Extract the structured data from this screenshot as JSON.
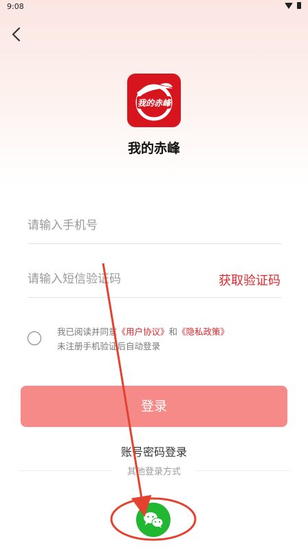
{
  "status_bar": {
    "time": "9:08"
  },
  "header": {
    "back_icon": "chevron-left-icon"
  },
  "app": {
    "logo_text": "我的赤峰",
    "name": "我的赤峰"
  },
  "form": {
    "phone_placeholder": "请输入手机号",
    "code_placeholder": "请输入短信验证码",
    "get_code_label": "获取验证码"
  },
  "agreement": {
    "prefix": "我已阅读并同意",
    "user_agreement": "《用户协议》",
    "and": "和",
    "privacy_policy": "《隐私政策》",
    "note": "未注册手机验证后自动登录"
  },
  "actions": {
    "login_label": "登录",
    "password_login_label": "账号密码登录",
    "other_methods_label": "其他登录方式",
    "wechat_icon": "wechat-icon"
  },
  "colors": {
    "accent_red": "#e0282e",
    "login_button": "#f58a89",
    "logo_bg": "#d7151e",
    "wechat_green": "#21b731",
    "annotation_red": "#e4412e"
  }
}
